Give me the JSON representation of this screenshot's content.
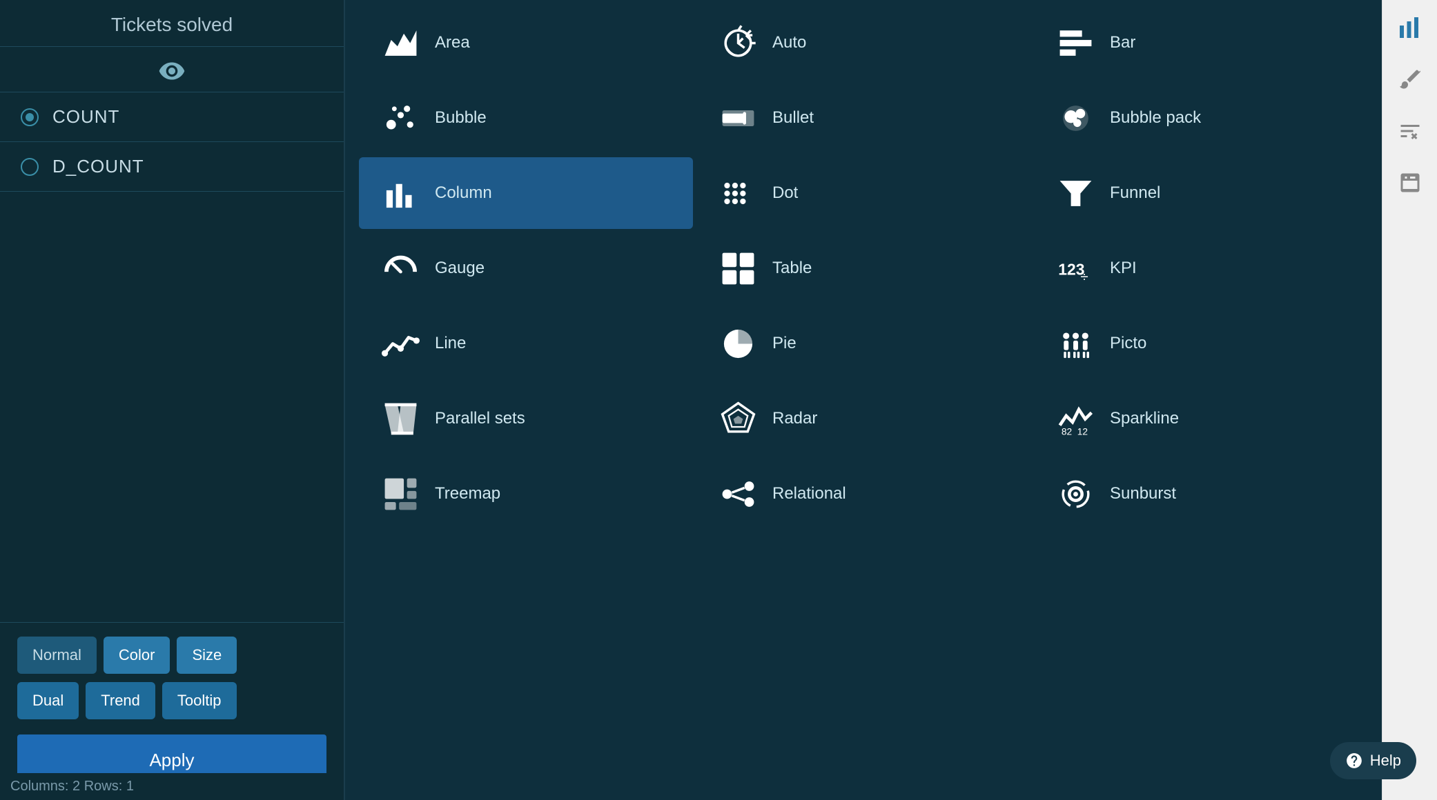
{
  "left_panel": {
    "title": "Tickets solved",
    "metrics": [
      {
        "id": "count",
        "label": "COUNT",
        "selected": true
      },
      {
        "id": "d_count",
        "label": "D_COUNT",
        "selected": false
      }
    ],
    "buttons_row1": [
      {
        "id": "normal",
        "label": "Normal",
        "style": "normal"
      },
      {
        "id": "color",
        "label": "Color",
        "style": "active"
      },
      {
        "id": "size",
        "label": "Size",
        "style": "active"
      }
    ],
    "buttons_row2": [
      {
        "id": "dual",
        "label": "Dual",
        "style": "active"
      },
      {
        "id": "trend",
        "label": "Trend",
        "style": "active"
      },
      {
        "id": "tooltip",
        "label": "Tooltip",
        "style": "active"
      }
    ],
    "apply_label": "Apply",
    "status": "Columns: 2    Rows: 1"
  },
  "chart_types": [
    {
      "id": "area",
      "label": "Area",
      "selected": false
    },
    {
      "id": "auto",
      "label": "Auto",
      "selected": false
    },
    {
      "id": "bar",
      "label": "Bar",
      "selected": false
    },
    {
      "id": "bubble",
      "label": "Bubble",
      "selected": false
    },
    {
      "id": "bullet",
      "label": "Bullet",
      "selected": false
    },
    {
      "id": "bubble-pack",
      "label": "Bubble pack",
      "selected": false
    },
    {
      "id": "column",
      "label": "Column",
      "selected": true
    },
    {
      "id": "dot",
      "label": "Dot",
      "selected": false
    },
    {
      "id": "funnel",
      "label": "Funnel",
      "selected": false
    },
    {
      "id": "gauge",
      "label": "Gauge",
      "selected": false
    },
    {
      "id": "table",
      "label": "Table",
      "selected": false
    },
    {
      "id": "kpi",
      "label": "KPI",
      "selected": false
    },
    {
      "id": "line",
      "label": "Line",
      "selected": false
    },
    {
      "id": "pie",
      "label": "Pie",
      "selected": false
    },
    {
      "id": "picto",
      "label": "Picto",
      "selected": false
    },
    {
      "id": "parallel-sets",
      "label": "Parallel sets",
      "selected": false
    },
    {
      "id": "radar",
      "label": "Radar",
      "selected": false
    },
    {
      "id": "sparkline",
      "label": "Sparkline",
      "selected": false
    },
    {
      "id": "treemap",
      "label": "Treemap",
      "selected": false
    },
    {
      "id": "relational",
      "label": "Relational",
      "selected": false
    },
    {
      "id": "sunburst",
      "label": "Sunburst",
      "selected": false
    }
  ],
  "right_sidebar": {
    "icons": [
      "bar-chart-icon",
      "paint-icon",
      "sort-icon",
      "calculator-icon"
    ]
  },
  "help_label": "Help"
}
